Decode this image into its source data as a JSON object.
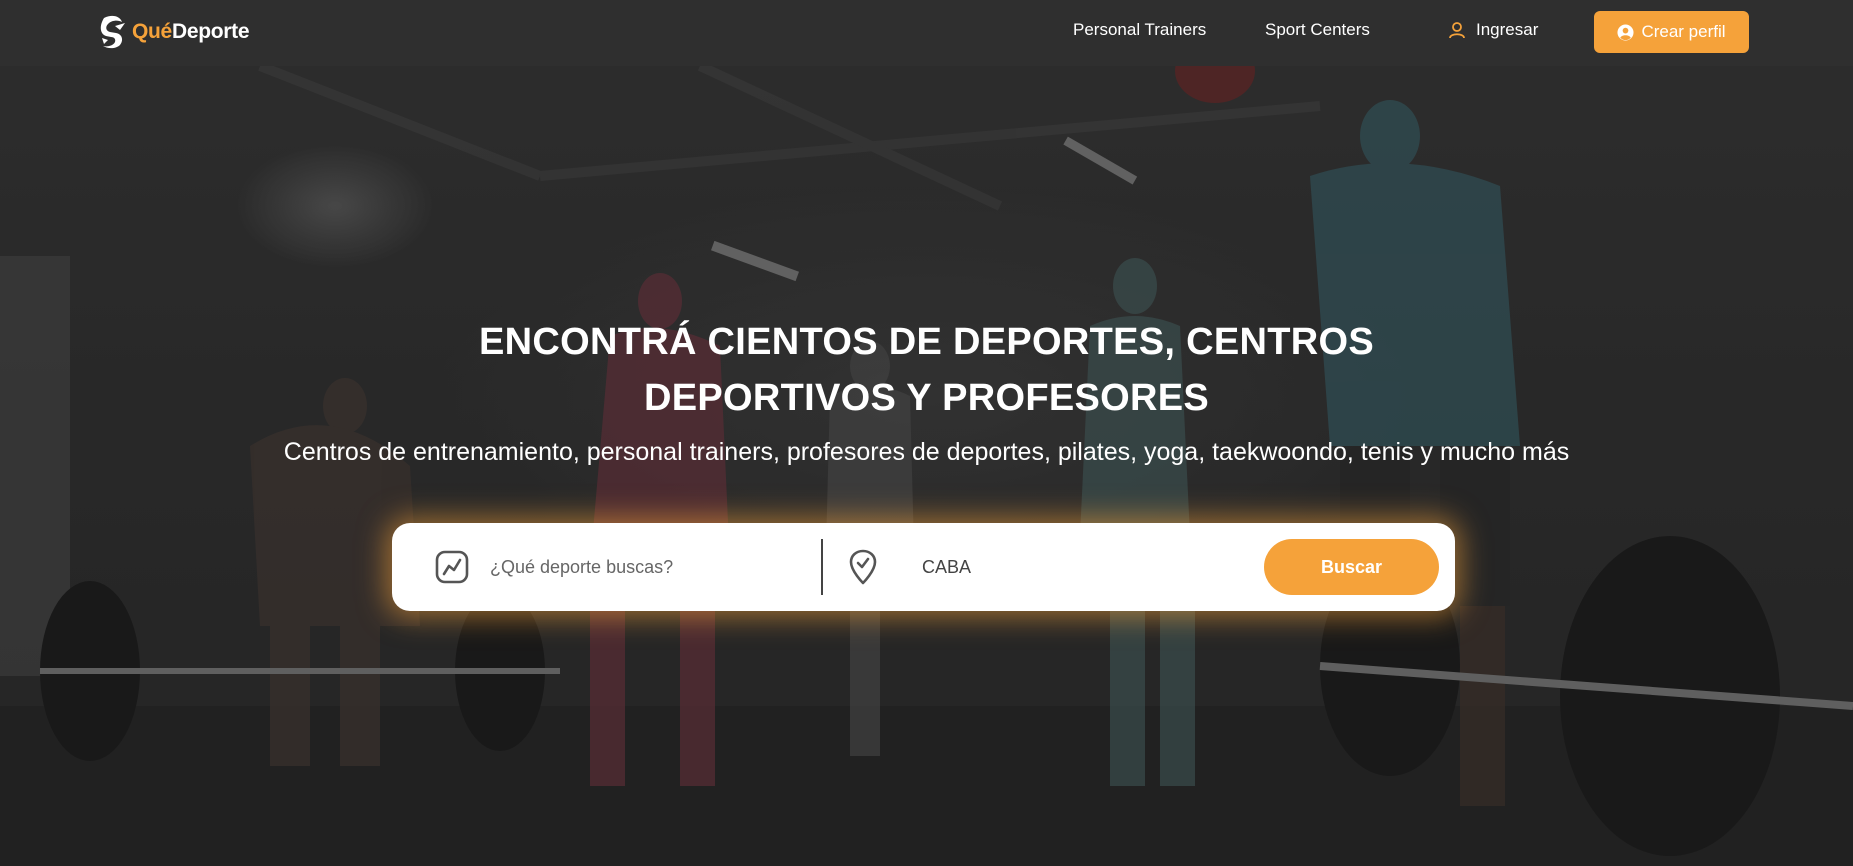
{
  "brand": {
    "name_part1": "Qué",
    "name_part2": "Deporte",
    "logo_icon": "runner-logo-icon"
  },
  "nav": {
    "links": [
      {
        "label": "Personal Trainers"
      },
      {
        "label": "Sport Centers"
      }
    ],
    "login": {
      "label": "Ingresar",
      "icon": "user-outline-icon"
    },
    "cta": {
      "label": "Crear perfil",
      "icon": "user-circle-icon"
    }
  },
  "hero": {
    "headline_line1": "ENCONTRÁ CIENTOS DE DEPORTES, CENTROS",
    "headline_line2": "DEPORTIVOS Y PROFESORES",
    "subtitle": "Centros de entrenamiento, personal trainers, profesores de deportes, pilates, yoga, taekwoondo, tenis y mucho más"
  },
  "search": {
    "sport_placeholder": "¿Qué deporte buscas?",
    "sport_icon": "trend-chart-icon",
    "location_value": "CABA",
    "location_icon": "location-pin-icon",
    "button_label": "Buscar"
  },
  "colors": {
    "accent": "#f5a23a",
    "navbar": "#2f2f2f",
    "text_light": "#ffffff"
  }
}
